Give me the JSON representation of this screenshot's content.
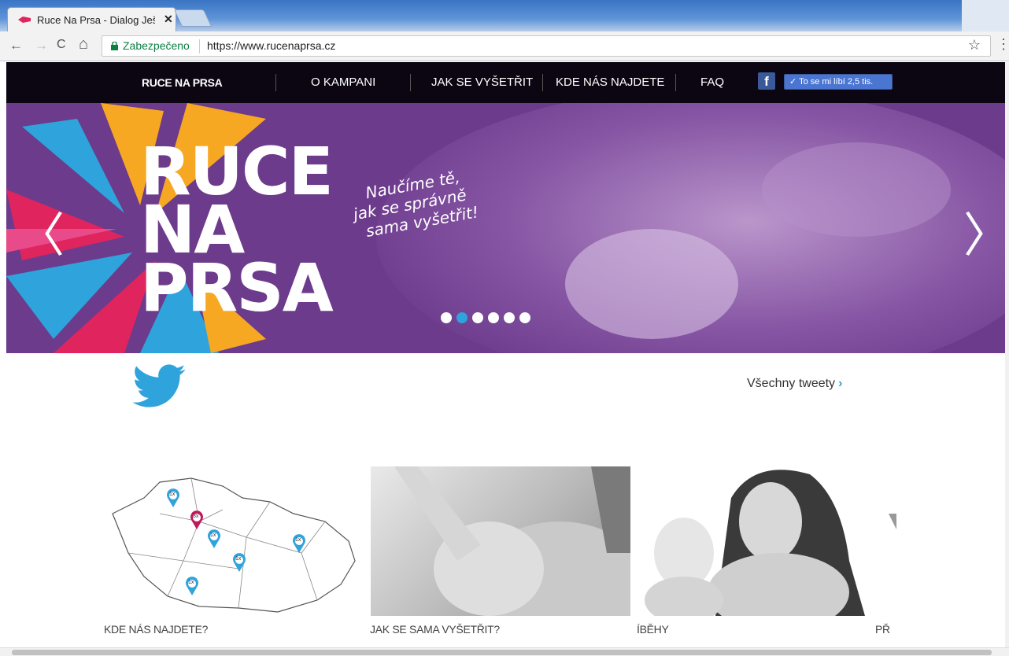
{
  "browser": {
    "tab_title": "Ruce Na Prsa - Dialog Ješ",
    "tab_close": "✕",
    "back": "←",
    "forward": "→",
    "reload": "C",
    "home": "⌂",
    "secure_label": "Zabezpečeno",
    "url": "https://www.rucenaprsa.cz",
    "star": "☆",
    "menu": "⋮"
  },
  "nav": {
    "logo": "RUCE NA PRSA",
    "items": [
      "O KAMPANI",
      "JAK SE VYŠETŘIT",
      "KDE NÁS NAJDETE",
      "FAQ"
    ],
    "fb_icon": "f",
    "like_label": "✓ To se mi líbí 2,5 tis."
  },
  "hero": {
    "title_lines": [
      "RUCE",
      "NA",
      "PRSA"
    ],
    "tagline_lines": [
      "Naučíme tě,",
      "jak se správně",
      "sama vyšetřit!"
    ],
    "prev": "〈",
    "next": "〉",
    "active_slide": 1,
    "slide_count": 6
  },
  "tweets": {
    "all_label": "Všechny tweety",
    "chevron": "›"
  },
  "cards": [
    {
      "caption": "KDE NÁS NAJDETE?"
    },
    {
      "caption": "JAK SE SAMA VYŠETŘIT?"
    },
    {
      "caption": "ÍBĚHY"
    },
    {
      "caption": "PŘ"
    }
  ],
  "map_pins": [
    "1x",
    "3x",
    "1x",
    "1x",
    "1x",
    "1x"
  ],
  "colors": {
    "nav_bg": "#0c0612",
    "hero_bg": "#6c3b8c",
    "accent": "#2fa3dc",
    "pin_red": "#c2185b"
  }
}
